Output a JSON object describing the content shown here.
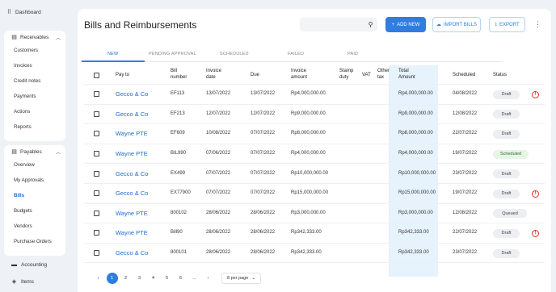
{
  "sidebar": {
    "top_item": "Dashboard",
    "group1": {
      "label": "Receivables",
      "items": [
        "Customers",
        "Invoices",
        "Credit notes",
        "Payments",
        "Actions",
        "Reports"
      ]
    },
    "group2": {
      "label": "Payables",
      "items": [
        "Overview",
        "My Approvals",
        "Bills",
        "Budgets",
        "Vendors",
        "Purchase Orders"
      ],
      "active_index": 2
    },
    "bottom_items": [
      "Accounting",
      "Items"
    ]
  },
  "page": {
    "title": "Bills and Reimbursements",
    "search_placeholder": "",
    "add_new": "ADD NEW",
    "import_bills": "IMPORT BILLS",
    "export": "EXPORT"
  },
  "tabs": [
    "NEW",
    "PENDING APPROVAL",
    "SCHEDULED",
    "FAILED",
    "PAID"
  ],
  "table": {
    "headers": {
      "pay_to": "Pay to",
      "bill_number": "Bill\nnumber",
      "invoice_date": "Invoice\ndate",
      "due": "Due",
      "invoice_amount": "Invoice\namount",
      "stamp_duty": "Stamp\nduty",
      "vat": "VAT",
      "other_tax": "Other\ntax",
      "total_amount": "Total\nAmount",
      "scheduled": "Scheduled",
      "status": "Status"
    },
    "rows": [
      {
        "pay_to": "Gecco & Co",
        "bill_number": "EF113",
        "invoice_date": "13/07/2022",
        "due": "13/07/2022",
        "invoice_amount": "Rp4,000,000.00",
        "total_amount": "Rp4,000,000.00",
        "scheduled": "04/08/2022",
        "status": "Draft",
        "status_type": "draft",
        "warning": true
      },
      {
        "pay_to": "Gecco & Co",
        "bill_number": "EF213",
        "invoice_date": "12/07/2022",
        "due": "12/07/2022",
        "invoice_amount": "Rp9,000,000.00",
        "total_amount": "Rp9,000,000.00",
        "scheduled": "12/08/2022",
        "status": "Draft",
        "status_type": "draft",
        "warning": false
      },
      {
        "pay_to": "Wayne PTE",
        "bill_number": "EF609",
        "invoice_date": "10/08/2022",
        "due": "07/07/2022",
        "invoice_amount": "Rp8,000,000.00",
        "total_amount": "Rp8,000,000.00",
        "scheduled": "22/07/2022",
        "status": "Draft",
        "status_type": "draft",
        "warning": false
      },
      {
        "pay_to": "Wayne PTE",
        "bill_number": "BIL990",
        "invoice_date": "07/06/2022",
        "due": "07/07/2022",
        "invoice_amount": "Rp4,000,000.00",
        "total_amount": "Rp4,000,000.00",
        "scheduled": "19/07/2022",
        "status": "Scheduled",
        "status_type": "scheduled",
        "warning": false
      },
      {
        "pay_to": "Gecco & Co",
        "bill_number": "EX499",
        "invoice_date": "07/07/2022",
        "due": "07/07/2022",
        "invoice_amount": "Rp10,000,000.00",
        "total_amount": "Rp10,000,000.00",
        "scheduled": "23/07/2022",
        "status": "Draft",
        "status_type": "draft",
        "warning": false
      },
      {
        "pay_to": "Gecco & Co",
        "bill_number": "EX77900",
        "invoice_date": "07/07/2022",
        "due": "07/07/2022",
        "invoice_amount": "Rp15,000,000.00",
        "total_amount": "Rp15,000,000.00",
        "scheduled": "19/07/2022",
        "status": "Draft",
        "status_type": "draft",
        "warning": true
      },
      {
        "pay_to": "Wayne PTE",
        "bill_number": "800102",
        "invoice_date": "28/06/2022",
        "due": "28/06/2022",
        "invoice_amount": "Rp3,000,000.00",
        "total_amount": "Rp3,000,000.00",
        "scheduled": "12/08/2022",
        "status": "Queued",
        "status_type": "draft",
        "warning": false
      },
      {
        "pay_to": "Wayne PTE",
        "bill_number": "Bill90",
        "invoice_date": "28/06/2022",
        "due": "28/06/2022",
        "invoice_amount": "Rp342,333.00",
        "total_amount": "Rp342,333.00",
        "scheduled": "22/07/2022",
        "status": "Draft",
        "status_type": "draft",
        "warning": true
      },
      {
        "pay_to": "Gecco & Co",
        "bill_number": "800101",
        "invoice_date": "28/06/2022",
        "due": "28/06/2022",
        "invoice_amount": "Rp342,333.00",
        "total_amount": "Rp342,333.00",
        "scheduled": "23/07/2022",
        "status": "Draft",
        "status_type": "draft",
        "warning": false
      }
    ]
  },
  "pagination": {
    "prev": "‹",
    "pages": [
      "1",
      "2",
      "3",
      "4",
      "5",
      "6",
      "..."
    ],
    "active": "1",
    "next": "›",
    "per_page": "8 per page"
  },
  "colors": {
    "primary": "#2f7de1",
    "link": "#1f6bd6",
    "highlight_column": "#e6f2fc",
    "warning": "#d9331a"
  }
}
